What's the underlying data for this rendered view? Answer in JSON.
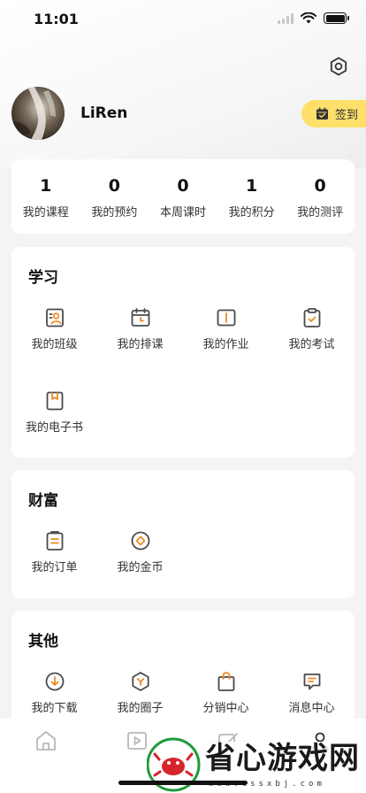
{
  "status_bar": {
    "time": "11:01"
  },
  "profile": {
    "username": "LiRen",
    "checkin_label": "签到"
  },
  "stats": [
    {
      "value": "1",
      "label": "我的课程"
    },
    {
      "value": "0",
      "label": "我的预约"
    },
    {
      "value": "0",
      "label": "本周课时"
    },
    {
      "value": "1",
      "label": "我的积分"
    },
    {
      "value": "0",
      "label": "我的测评"
    }
  ],
  "sections": {
    "study": {
      "title": "学习",
      "items": [
        {
          "label": "我的班级",
          "icon": "class-icon"
        },
        {
          "label": "我的排课",
          "icon": "calendar-icon"
        },
        {
          "label": "我的作业",
          "icon": "book-icon"
        },
        {
          "label": "我的考试",
          "icon": "clipboard-check-icon"
        },
        {
          "label": "我的电子书",
          "icon": "ebook-icon"
        }
      ]
    },
    "wealth": {
      "title": "财富",
      "items": [
        {
          "label": "我的订单",
          "icon": "order-icon"
        },
        {
          "label": "我的金币",
          "icon": "coin-icon"
        }
      ]
    },
    "other": {
      "title": "其他",
      "items": [
        {
          "label": "我的下载",
          "icon": "download-icon"
        },
        {
          "label": "我的圈子",
          "icon": "circle-icon"
        },
        {
          "label": "分销中心",
          "icon": "shopping-bag-icon"
        },
        {
          "label": "消息中心",
          "icon": "message-icon"
        }
      ]
    }
  },
  "watermark": {
    "text": "省心游戏网",
    "url": "www.cssxbj.com"
  },
  "colors": {
    "accent": "#f08a24",
    "icon_dark": "#4a4a4a",
    "checkin_bg": "#fde06a"
  }
}
